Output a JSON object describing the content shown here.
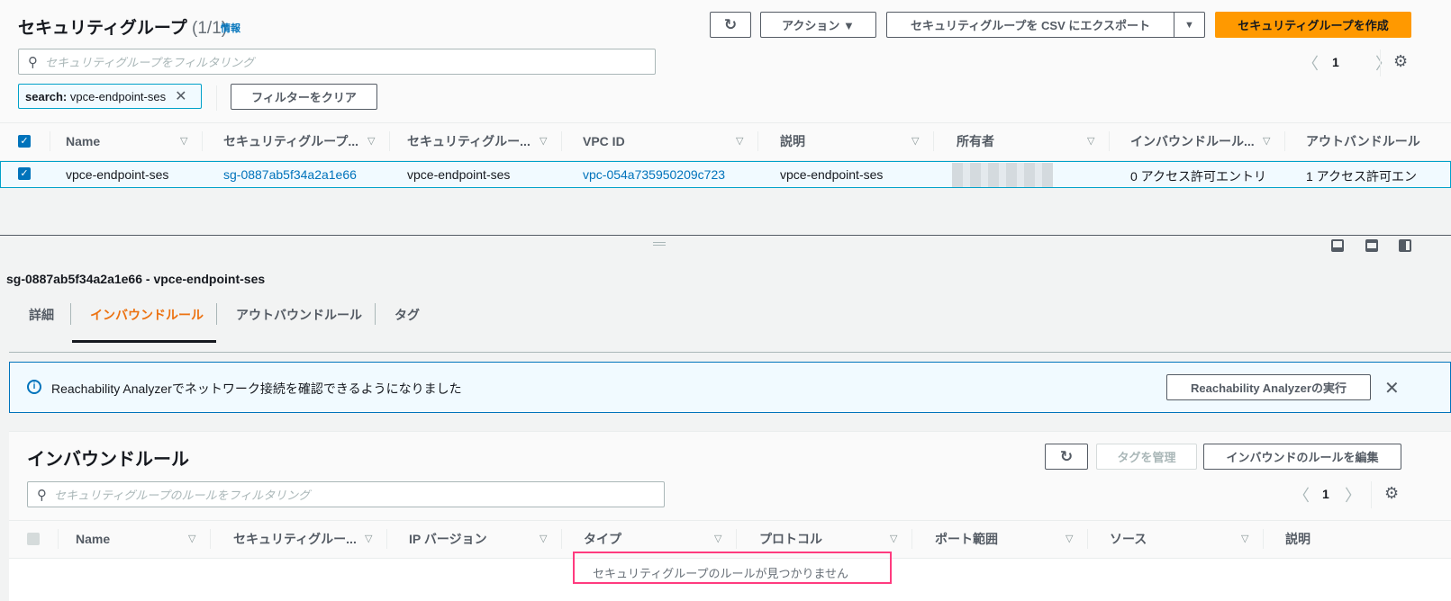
{
  "header": {
    "title": "セキュリティグループ",
    "count": "(1/1)",
    "info_link": "情報"
  },
  "toolbar": {
    "refresh": "refresh-icon",
    "actions": "アクション ▼",
    "export": "セキュリティグループを CSV にエクスポート",
    "export_caret": "▼",
    "create": "セキュリティグループを作成"
  },
  "search": {
    "placeholder": "セキュリティグループをフィルタリング",
    "chip_key": "search:",
    "chip_value": "vpce-endpoint-ses",
    "clear": "フィルターをクリア"
  },
  "pagination": {
    "page": "1"
  },
  "table": {
    "columns": [
      "Name",
      "セキュリティグループ...",
      "セキュリティグルー...",
      "VPC ID",
      "説明",
      "所有者",
      "インバウンドルール...",
      "アウトバンドルール"
    ],
    "rows": [
      {
        "name": "vpce-endpoint-ses",
        "sg_id": "sg-0887ab5f34a2a1e66",
        "sg_name": "vpce-endpoint-ses",
        "vpc_id": "vpc-054a735950209c723",
        "description": "vpce-endpoint-ses",
        "owner": "",
        "inbound": "0 アクセス許可エントリ",
        "outbound": "1 アクセス許可エン"
      }
    ]
  },
  "detail": {
    "title": "sg-0887ab5f34a2a1e66 - vpce-endpoint-ses",
    "tabs": [
      "詳細",
      "インバウンドルール",
      "アウトバウンドルール",
      "タグ"
    ],
    "active_tab": "インバウンドルール",
    "banner": {
      "text": "Reachability Analyzerでネットワーク接続を確認できるようになりました",
      "button": "Reachability Analyzerの実行"
    },
    "rules": {
      "title": "インバウンドルール",
      "manage_tags": "タグを管理",
      "edit": "インバウンドのルールを編集",
      "placeholder": "セキュリティグループのルールをフィルタリング",
      "page": "1",
      "columns": [
        "Name",
        "セキュリティグルー...",
        "IP バージョン",
        "タイプ",
        "プロトコル",
        "ポート範囲",
        "ソース",
        "説明"
      ],
      "empty": "セキュリティグループのルールが見つかりません"
    }
  },
  "colors": {
    "accent": "#0073bb",
    "primary": "#ff9900",
    "active_tab": "#ec7211",
    "highlight": "#ff3b7f"
  }
}
